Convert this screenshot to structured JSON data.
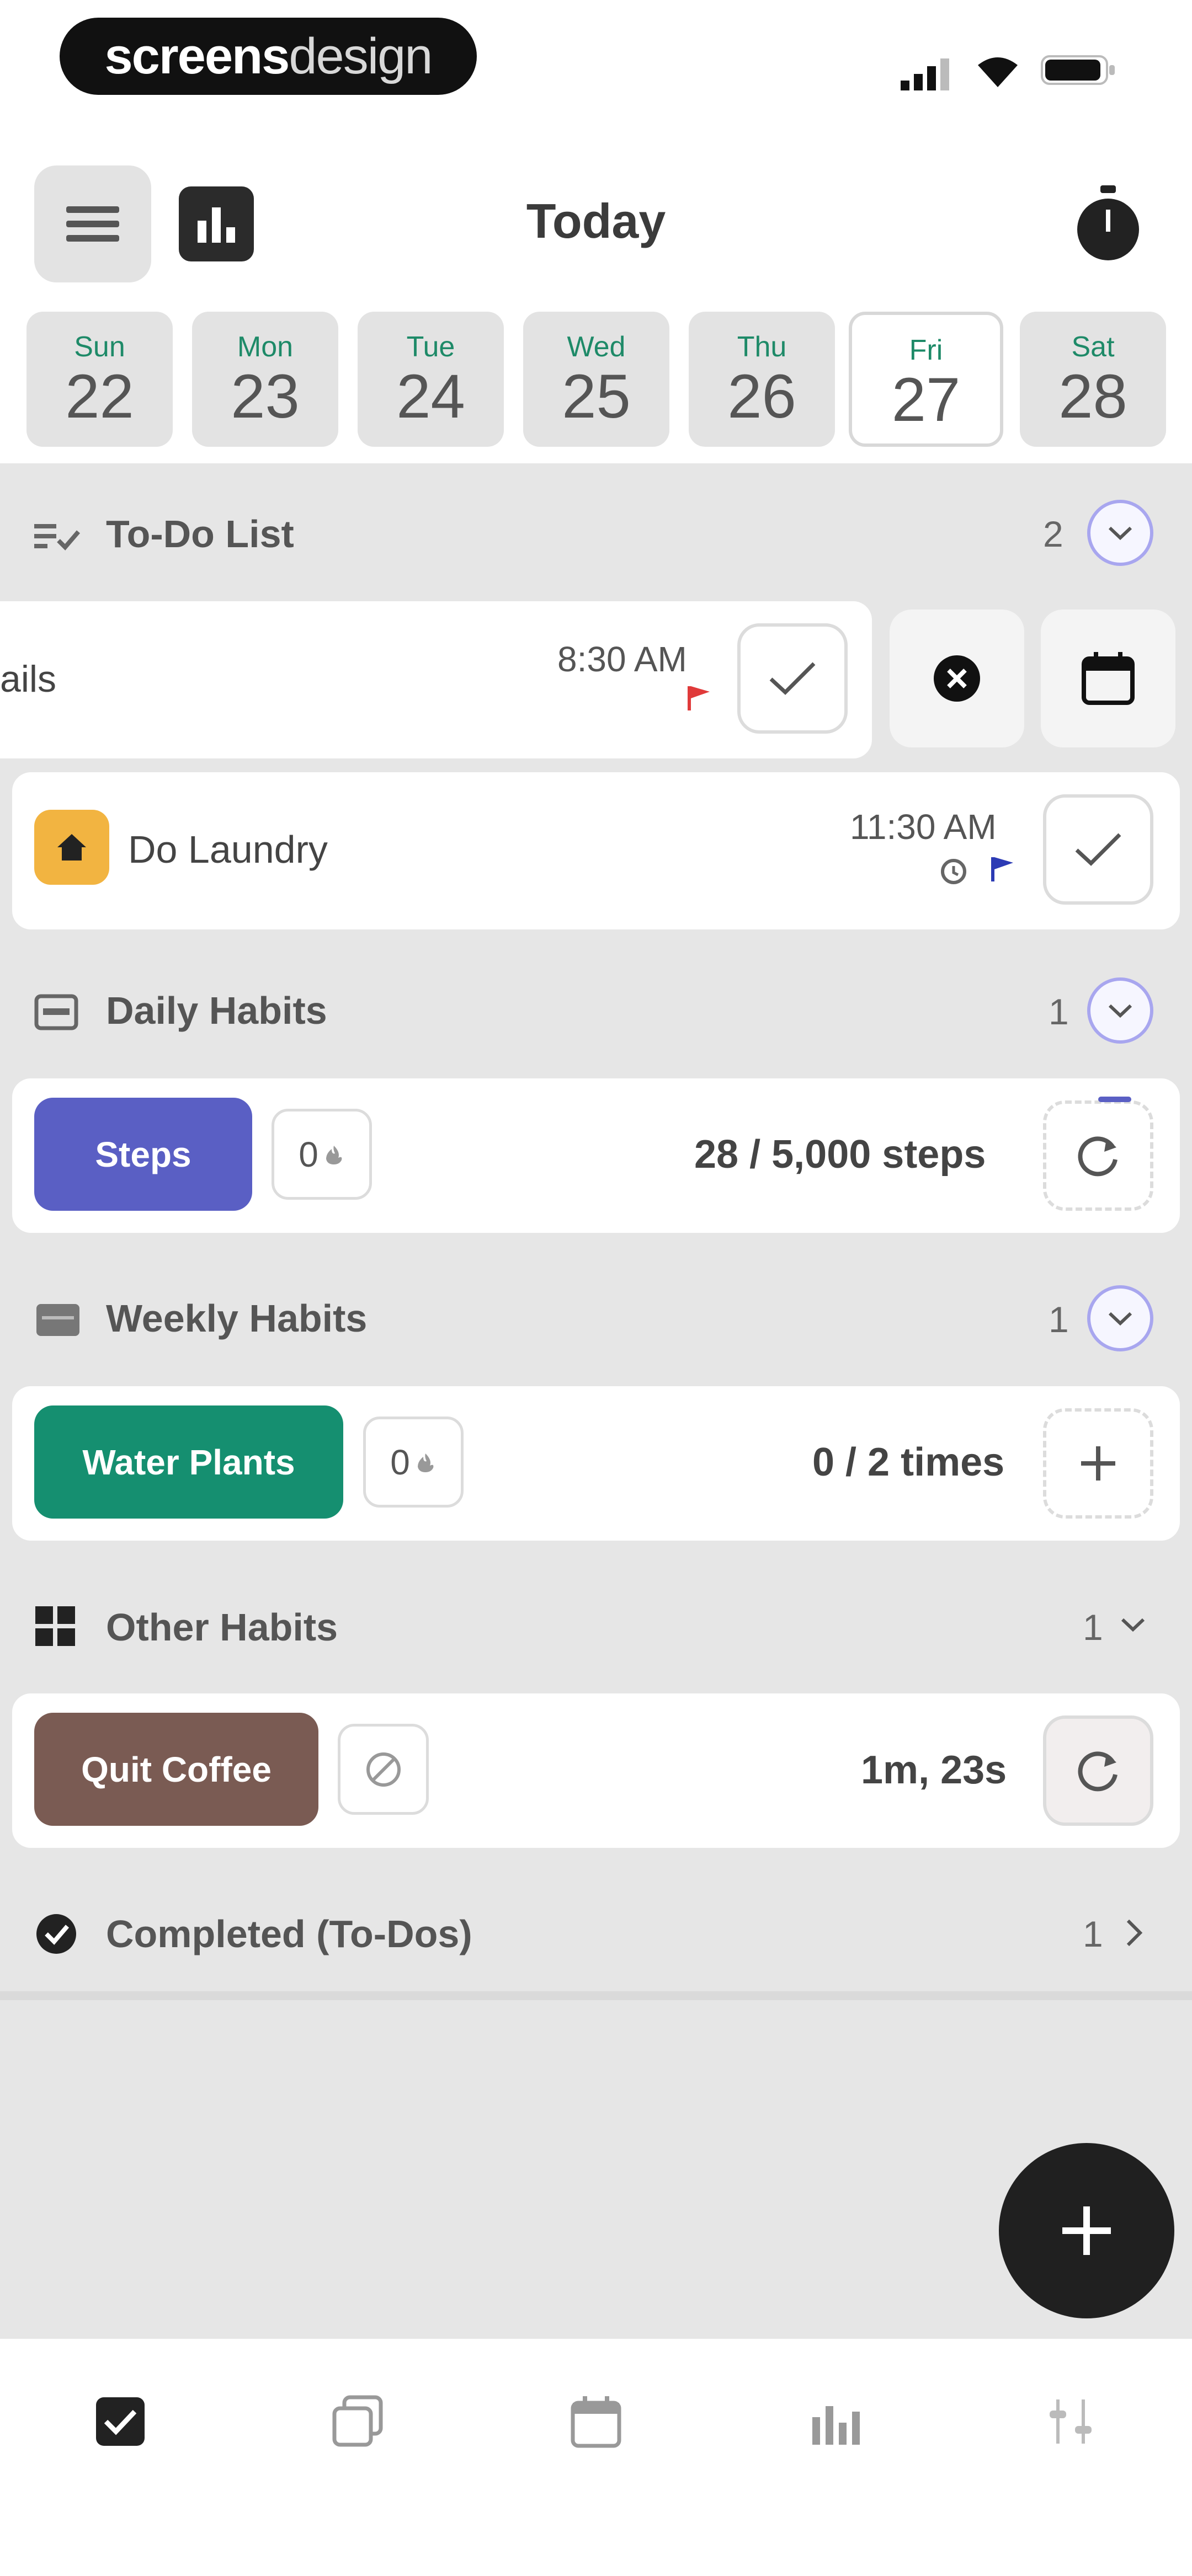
{
  "brand": {
    "bold": "screens",
    "light": "design"
  },
  "header": {
    "title": "Today"
  },
  "days": [
    {
      "name": "Sun",
      "date": "22"
    },
    {
      "name": "Mon",
      "date": "23"
    },
    {
      "name": "Tue",
      "date": "24"
    },
    {
      "name": "Wed",
      "date": "25"
    },
    {
      "name": "Thu",
      "date": "26"
    },
    {
      "name": "Fri",
      "date": "27",
      "selected": true
    },
    {
      "name": "Sat",
      "date": "28"
    }
  ],
  "todo": {
    "title": "To-Do List",
    "count": "2",
    "items": [
      {
        "label": "ails",
        "time": "8:30 AM",
        "flag_color": "#e03a3a"
      },
      {
        "label": "Do Laundry",
        "time": "11:30 AM",
        "flag_color": "#2c3bb5",
        "icon_bg": "#f2b441"
      }
    ]
  },
  "daily": {
    "title": "Daily Habits",
    "count": "1",
    "habit": {
      "label": "Steps",
      "streak": "0",
      "progress": "28 / 5,000 steps",
      "color": "#5a5fc4"
    }
  },
  "weekly": {
    "title": "Weekly Habits",
    "count": "1",
    "habit": {
      "label": "Water Plants",
      "streak": "0",
      "progress": "0 / 2 times",
      "color": "#158f70"
    }
  },
  "other": {
    "title": "Other Habits",
    "count": "1",
    "habit": {
      "label": "Quit Coffee",
      "progress": "1m, 23s",
      "color": "#7a5b53"
    }
  },
  "completed": {
    "title": "Completed (To-Dos)",
    "count": "1"
  }
}
